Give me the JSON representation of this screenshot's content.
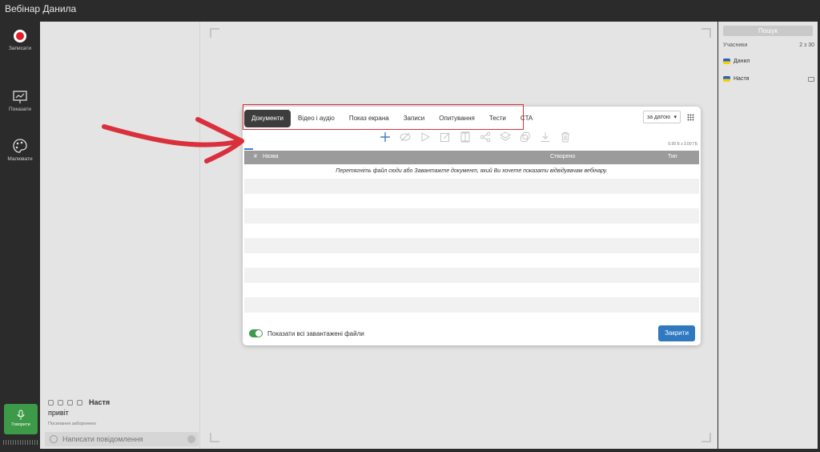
{
  "window": {
    "title": "Вебінар Данила"
  },
  "leftbar": {
    "record_label": "Записати",
    "show_label": "Показати",
    "draw_label": "Малювати",
    "speak_label": "Говорити"
  },
  "chat": {
    "author": "Настя",
    "message": "привіт",
    "note": "Посилання заборонено",
    "input_placeholder": "Написати повідомлення"
  },
  "participants": {
    "search_label": "Пошук",
    "header_label": "Учасники",
    "count": "2 з 30",
    "list": [
      {
        "name": "Данил"
      },
      {
        "name": "Настя"
      }
    ]
  },
  "modal": {
    "tabs": [
      {
        "label": "Документи",
        "active": true
      },
      {
        "label": "Відео і аудіо"
      },
      {
        "label": "Показ екрана"
      },
      {
        "label": "Записи"
      },
      {
        "label": "Опитування"
      },
      {
        "label": "Тести"
      },
      {
        "label": "CTA"
      }
    ],
    "sort_label": "за датою",
    "storage": "0.00 Б з 3.00 ГБ",
    "columns": {
      "num": "#",
      "name": "Назва",
      "created": "Створено",
      "type": "Тип"
    },
    "empty_message": "Перетягніть файл сюди або Завантажте документ, який Ви хочете показати відвідувачам вебінару.",
    "toggle_label": "Показати всі завантажені файли",
    "close_label": "Закрити"
  },
  "colors": {
    "accent_blue": "#2f79c1",
    "record_red": "#e21f26",
    "speak_green": "#3c9a49",
    "annotation_red": "#d9303b"
  }
}
